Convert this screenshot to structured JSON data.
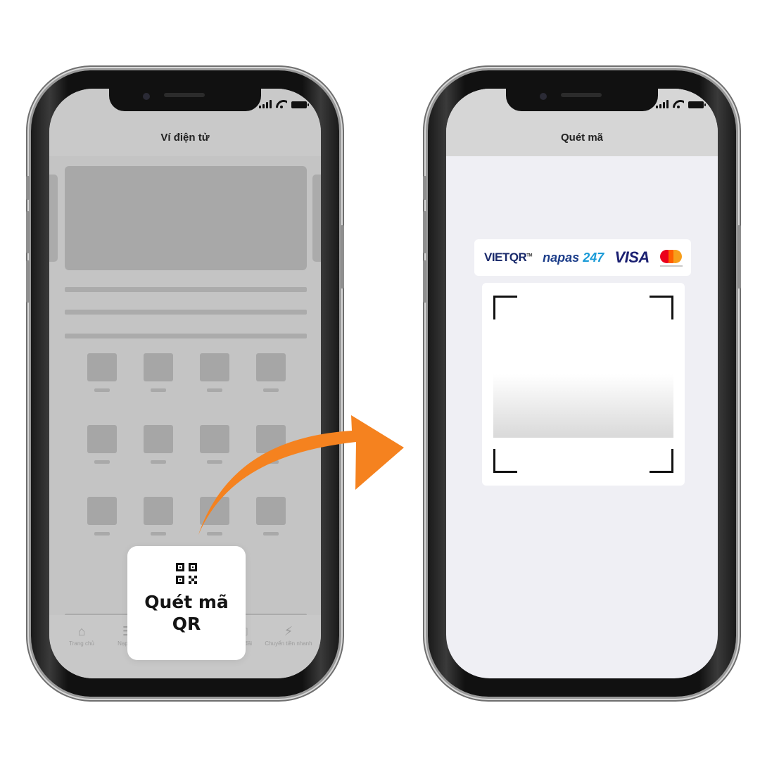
{
  "left_phone": {
    "header_title": "Ví điện tử",
    "tabs": [
      {
        "icon": "home-icon",
        "label": "Trang chủ"
      },
      {
        "icon": "list-icon",
        "label": "Nạp tiền"
      },
      {
        "icon": "gift-icon",
        "label": "Ưu đãi"
      },
      {
        "icon": "flash-icon",
        "label": "Chuyển tiền nhanh"
      }
    ],
    "scan_card": {
      "icon": "qr-code-icon",
      "label": "Quét mã\nQR"
    }
  },
  "right_phone": {
    "header_title": "Quét mã",
    "brands": {
      "vietqr": "VIETQR",
      "vietqr_tm": "TM",
      "napas": "napas",
      "napas_247": "247",
      "visa": "VISA",
      "mastercard_icon": "mastercard-logo"
    }
  },
  "colors": {
    "arrow": "#f5821f",
    "vietqr_red": "#d72229",
    "napas_blue": "#1d3e8a",
    "visa_blue": "#1a1f71"
  }
}
